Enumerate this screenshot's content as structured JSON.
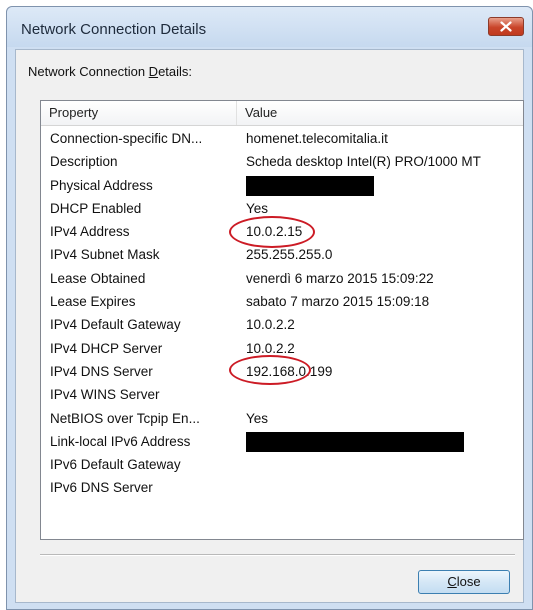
{
  "window": {
    "title": "Network Connection Details",
    "close_icon": "x-close-icon"
  },
  "group": {
    "label_prefix": "Network Connection ",
    "label_accel": "D",
    "label_suffix": "etails:"
  },
  "list": {
    "columns": [
      "Property",
      "Value"
    ],
    "rows": [
      {
        "property": "Connection-specific DN...",
        "value": "homenet.telecomitalia.it"
      },
      {
        "property": "Description",
        "value": "Scheda desktop Intel(R) PRO/1000 MT"
      },
      {
        "property": "Physical Address",
        "value": ""
      },
      {
        "property": "DHCP Enabled",
        "value": "Yes"
      },
      {
        "property": "IPv4 Address",
        "value": "10.0.2.15"
      },
      {
        "property": "IPv4 Subnet Mask",
        "value": "255.255.255.0"
      },
      {
        "property": "Lease Obtained",
        "value": "venerdì 6 marzo 2015 15:09:22"
      },
      {
        "property": "Lease Expires",
        "value": "sabato 7 marzo 2015 15:09:18"
      },
      {
        "property": "IPv4 Default Gateway",
        "value": "10.0.2.2"
      },
      {
        "property": "IPv4 DHCP Server",
        "value": "10.0.2.2"
      },
      {
        "property": "IPv4 DNS Server",
        "value": "192.168.0.199"
      },
      {
        "property": "IPv4 WINS Server",
        "value": ""
      },
      {
        "property": "NetBIOS over Tcpip En...",
        "value": "Yes"
      },
      {
        "property": "Link-local IPv6 Address",
        "value": ""
      },
      {
        "property": "IPv6 Default Gateway",
        "value": ""
      },
      {
        "property": "IPv6 DNS Server",
        "value": ""
      }
    ]
  },
  "footer": {
    "close_accel": "C",
    "close_rest": "lose"
  },
  "colors": {
    "annotation": "#cc1b25",
    "redaction": "#000000",
    "close_button_red": "#c9452a"
  }
}
